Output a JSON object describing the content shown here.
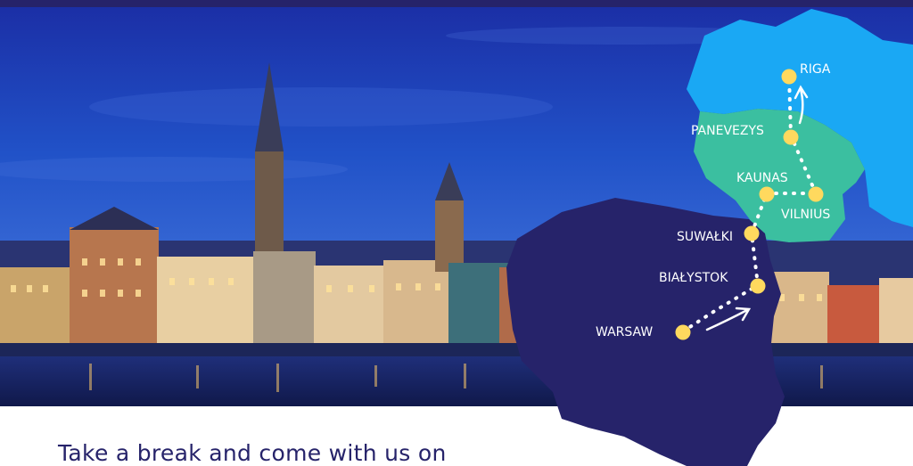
{
  "header_bar_color": "#26236a",
  "tagline": "Take a break and come with us on",
  "colors": {
    "poland": "#26236a",
    "lithuania": "#3bbfa0",
    "latvia": "#1aa8f4",
    "marker": "#ffd95e",
    "route": "#ffffff"
  },
  "route": {
    "stops": [
      "WARSAW",
      "BIAŁYSTOK",
      "SUWAŁKI",
      "KAUNAS",
      "VILNIUS",
      "PANEVEZYS",
      "RIGA"
    ]
  },
  "cities": {
    "warsaw": "WARSAW",
    "bialystok": "BIAŁYSTOK",
    "suwalki": "SUWAŁKI",
    "kaunas": "KAUNAS",
    "vilnius": "VILNIUS",
    "panevezys": "PANEVEZYS",
    "riga": "RIGA"
  }
}
